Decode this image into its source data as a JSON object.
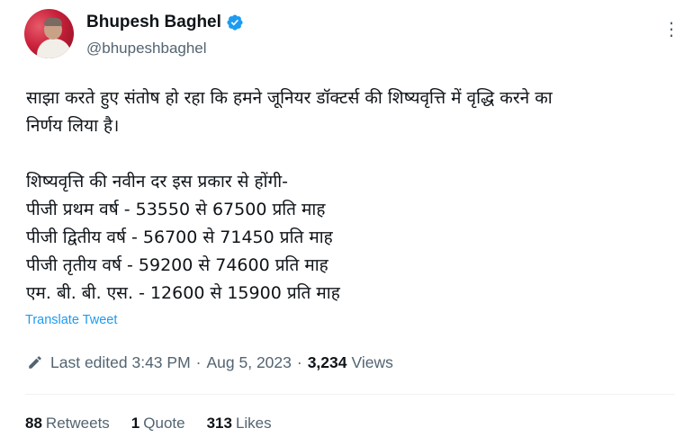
{
  "author": {
    "display_name": "Bhupesh Baghel",
    "handle": "@bhupeshbaghel",
    "verified": true
  },
  "tweet": {
    "lines": [
      "साझा करते हुए संतोष हो रहा कि हमने जूनियर डॉक्टर्स की शिष्यवृत्ति में वृद्धि करने का",
      "निर्णय लिया है।",
      "",
      "शिष्यवृत्ति की नवीन दर इस प्रकार से होंगी-",
      "पीजी प्रथम वर्ष - 53550 से 67500 प्रति माह",
      "पीजी द्वितीय वर्ष - 56700 से 71450 प्रति माह",
      "पीजी तृतीय वर्ष - 59200 से 74600 प्रति माह",
      "एम. बी. बी. एस. - 12600 से 15900 प्रति माह"
    ],
    "translate_label": "Translate Tweet"
  },
  "meta": {
    "edited_label": "Last edited 3:43 PM",
    "separator": "·",
    "date": "Aug 5, 2023",
    "views_count": "3,234",
    "views_label": "Views"
  },
  "stats": {
    "retweets_count": "88",
    "retweets_label": "Retweets",
    "quotes_count": "1",
    "quotes_label": "Quote",
    "likes_count": "313",
    "likes_label": "Likes"
  },
  "colors": {
    "text": "#0f1419",
    "secondary": "#536471",
    "link": "#1d9bf0",
    "verified_badge": "#1d9bf0"
  }
}
